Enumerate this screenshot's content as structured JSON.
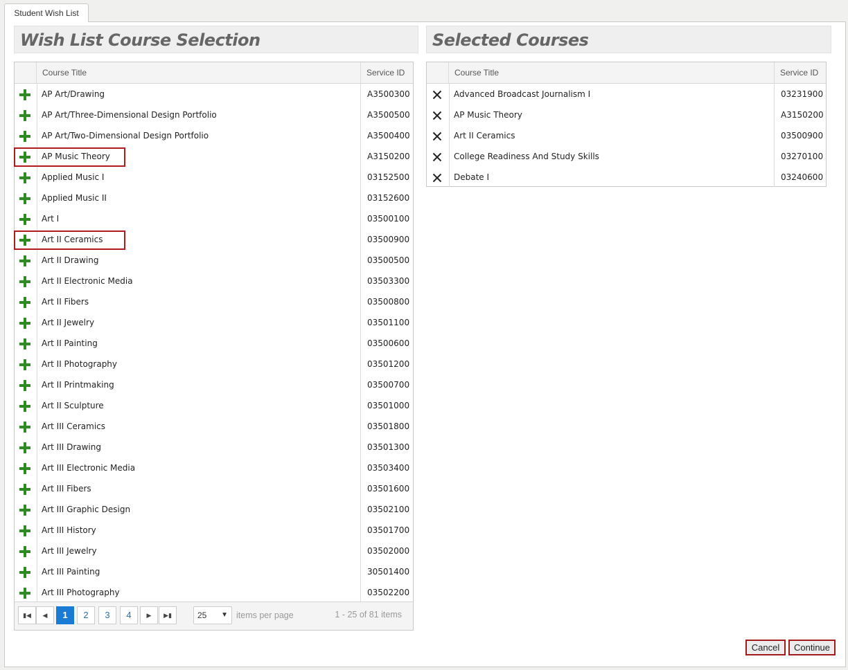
{
  "tab": {
    "label": "Student Wish List"
  },
  "left": {
    "title": "Wish List Course Selection",
    "col_title": "Course Title",
    "col_id": "Service ID",
    "rows": [
      {
        "title": "AP Art/Drawing",
        "id": "A3500300"
      },
      {
        "title": "AP Art/Three-Dimensional Design Portfolio",
        "id": "A3500500"
      },
      {
        "title": "AP Art/Two-Dimensional Design Portfolio",
        "id": "A3500400"
      },
      {
        "title": "AP Music Theory",
        "id": "A3150200",
        "highlighted": true
      },
      {
        "title": "Applied Music I",
        "id": "03152500"
      },
      {
        "title": "Applied Music II",
        "id": "03152600"
      },
      {
        "title": "Art I",
        "id": "03500100"
      },
      {
        "title": "Art II Ceramics",
        "id": "03500900",
        "highlighted": true
      },
      {
        "title": "Art II Drawing",
        "id": "03500500"
      },
      {
        "title": "Art II Electronic Media",
        "id": "03503300"
      },
      {
        "title": "Art II Fibers",
        "id": "03500800"
      },
      {
        "title": "Art II Jewelry",
        "id": "03501100"
      },
      {
        "title": "Art II Painting",
        "id": "03500600"
      },
      {
        "title": "Art II Photography",
        "id": "03501200"
      },
      {
        "title": "Art II Printmaking",
        "id": "03500700"
      },
      {
        "title": "Art II Sculpture",
        "id": "03501000"
      },
      {
        "title": "Art III Ceramics",
        "id": "03501800"
      },
      {
        "title": "Art III Drawing",
        "id": "03501300"
      },
      {
        "title": "Art III Electronic Media",
        "id": "03503400"
      },
      {
        "title": "Art III Fibers",
        "id": "03501600"
      },
      {
        "title": "Art III Graphic Design",
        "id": "03502100"
      },
      {
        "title": "Art III History",
        "id": "03501700"
      },
      {
        "title": "Art III Jewelry",
        "id": "03502000"
      },
      {
        "title": "Art III Painting",
        "id": "30501400"
      },
      {
        "title": "Art III Photography",
        "id": "03502200"
      }
    ],
    "pager": {
      "pages": [
        "1",
        "2",
        "3",
        "4"
      ],
      "current": "1",
      "page_size": "25",
      "items_label": "items per page",
      "info": "1 - 25 of 81 items"
    }
  },
  "right": {
    "title": "Selected Courses",
    "col_title": "Course Title",
    "col_id": "Service ID",
    "rows": [
      {
        "title": "Advanced Broadcast Journalism I",
        "id": "03231900"
      },
      {
        "title": "AP Music Theory",
        "id": "A3150200"
      },
      {
        "title": "Art II Ceramics",
        "id": "03500900"
      },
      {
        "title": "College Readiness And Study Skills",
        "id": "03270100"
      },
      {
        "title": "Debate I",
        "id": "03240600"
      }
    ]
  },
  "buttons": {
    "cancel": "Cancel",
    "continue": "Continue"
  },
  "icons": {
    "add": "plus-icon",
    "remove": "close-icon"
  },
  "colors": {
    "add_icon": "#2e8b22",
    "highlight": "#b11a1a",
    "pager_active": "#1a7bd4"
  }
}
